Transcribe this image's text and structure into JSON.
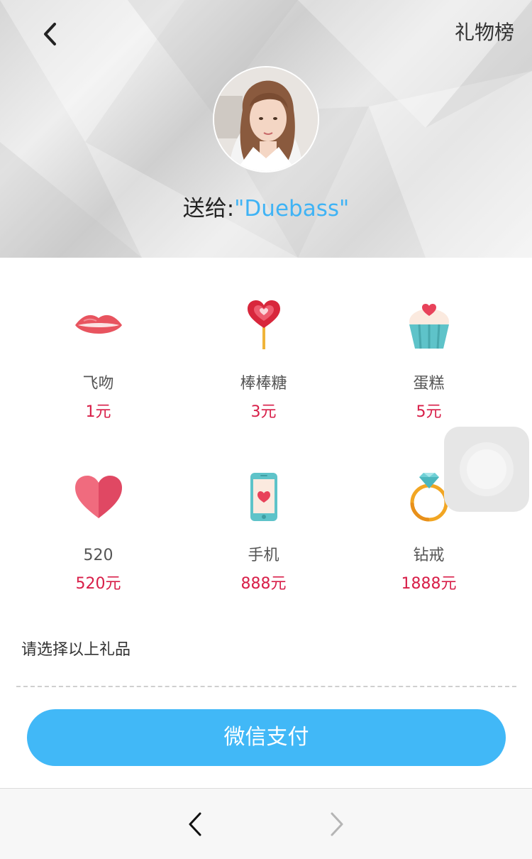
{
  "header": {
    "back_icon": "chevron-left-icon",
    "rank_label": "礼物榜",
    "avatar_icon": "avatar-photo",
    "send_prefix": "送给:",
    "recipient_name": "\"Duebass\""
  },
  "gifts": [
    {
      "name": "飞吻",
      "price": "1元",
      "icon": "lips-icon"
    },
    {
      "name": "棒棒糖",
      "price": "3元",
      "icon": "lollipop-icon"
    },
    {
      "name": "蛋糕",
      "price": "5元",
      "icon": "cupcake-icon"
    },
    {
      "name": "520",
      "price": "520元",
      "icon": "heart-icon"
    },
    {
      "name": "手机",
      "price": "888元",
      "icon": "phone-icon"
    },
    {
      "name": "钻戒",
      "price": "1888元",
      "icon": "diamond-ring-icon"
    }
  ],
  "hint_text": "请选择以上礼品",
  "pay_button_label": "微信支付",
  "colors": {
    "accent": "#41b8f7",
    "price": "#d81e48",
    "name_highlight": "#3fb3f5"
  },
  "bottom_nav": {
    "back_icon": "chevron-left-icon",
    "forward_icon": "chevron-right-icon"
  }
}
